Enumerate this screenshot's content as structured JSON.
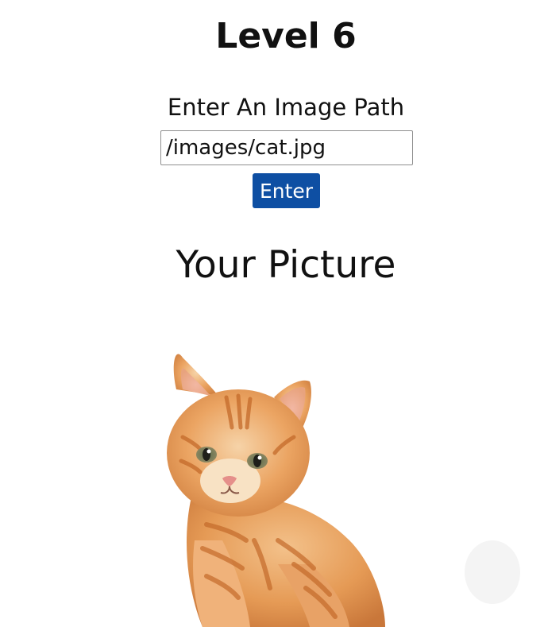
{
  "header": {
    "title": "Level 6"
  },
  "form": {
    "label": "Enter An Image Path",
    "input_value": "/images/cat.jpg",
    "button_label": "Enter"
  },
  "result": {
    "heading": "Your Picture",
    "image_subject": "orange-tabby-kitten"
  },
  "colors": {
    "button_bg": "#0e4fa3",
    "button_text": "#ffffff",
    "cat_orange": "#e59a55",
    "cat_light": "#f6cfa1"
  }
}
